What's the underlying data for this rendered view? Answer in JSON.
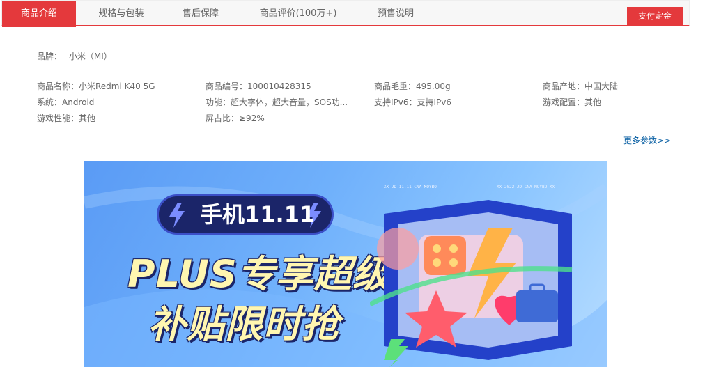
{
  "tabs": [
    {
      "label": "商品介绍",
      "active": true
    },
    {
      "label": "规格与包装",
      "active": false
    },
    {
      "label": "售后保障",
      "active": false
    },
    {
      "label": "商品评价(100万+)",
      "active": false
    },
    {
      "label": "预售说明",
      "active": false
    }
  ],
  "buy_button": "支付定金",
  "brand": {
    "label": "品牌：",
    "value": "小米（MI）"
  },
  "params": [
    "商品名称：小米Redmi K40 5G",
    "商品编号：100010428315",
    "商品毛重：495.00g",
    "商品产地：中国大陆",
    "系统：Android",
    "功能：超大字体，超大音量，SOS功...",
    "支持IPv6：支持IPv6",
    "游戏配置：其他",
    "游戏性能：其他",
    "屏占比：≥92%"
  ],
  "more_params": "更多参数>>",
  "banner": {
    "pill_text": "手机11.11",
    "headline_1": "PLUS专享超级",
    "headline_2": "补贴限时抢",
    "deco_1": "XX JD 11.11 CNA MOYBO",
    "deco_2": "XX 2022 JD CNA MOYBO XX"
  }
}
